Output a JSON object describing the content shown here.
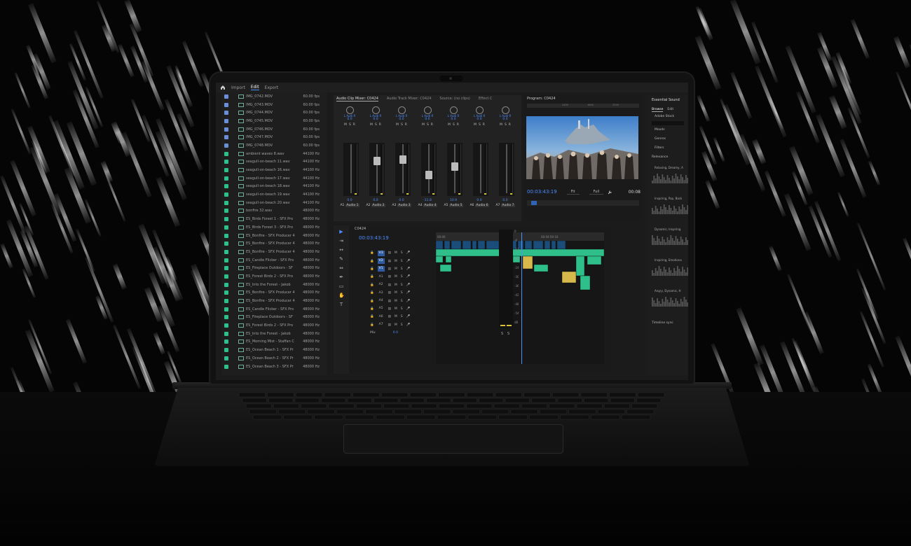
{
  "app": {
    "workspace_tabs": [
      "Import",
      "Edit",
      "Export"
    ],
    "active_tab": "Edit"
  },
  "project": {
    "items": [
      {
        "name": "IMG_0742.MOV",
        "rate": "60.00 fps",
        "type": "video"
      },
      {
        "name": "IMG_0743.MOV",
        "rate": "60.00 fps",
        "type": "video"
      },
      {
        "name": "IMG_0744.MOV",
        "rate": "60.00 fps",
        "type": "video"
      },
      {
        "name": "IMG_0745.MOV",
        "rate": "60.00 fps",
        "type": "video"
      },
      {
        "name": "IMG_0746.MOV",
        "rate": "60.00 fps",
        "type": "video"
      },
      {
        "name": "IMG_0747.MOV",
        "rate": "60.00 fps",
        "type": "video"
      },
      {
        "name": "IMG_0748.MOV",
        "rate": "60.00 fps",
        "type": "video"
      },
      {
        "name": "ambient waves 8.wav",
        "rate": "44100 Hz",
        "type": "audio"
      },
      {
        "name": "seagull-on-beach 11.wav",
        "rate": "44100 Hz",
        "type": "audio"
      },
      {
        "name": "seagull-on-beach 16.wav",
        "rate": "44100 Hz",
        "type": "audio"
      },
      {
        "name": "seagull-on-beach 17.wav",
        "rate": "44100 Hz",
        "type": "audio"
      },
      {
        "name": "seagull-on-beach 18.wav",
        "rate": "44100 Hz",
        "type": "audio"
      },
      {
        "name": "seagull-on-beach 19.wav",
        "rate": "44100 Hz",
        "type": "audio"
      },
      {
        "name": "seagull-on-beach 20.wav",
        "rate": "44100 Hz",
        "type": "audio"
      },
      {
        "name": "bonfire 32.wav",
        "rate": "48000 Hz",
        "type": "audio"
      },
      {
        "name": "ES_Birds Forest 1 - SFX Pro",
        "rate": "48000 Hz",
        "type": "audio"
      },
      {
        "name": "ES_Birds Forest 3 - SFX Pro",
        "rate": "48000 Hz",
        "type": "audio"
      },
      {
        "name": "ES_Bonfire - SFX Producer 4",
        "rate": "48000 Hz",
        "type": "audio"
      },
      {
        "name": "ES_Bonfire - SFX Producer 4",
        "rate": "48000 Hz",
        "type": "audio"
      },
      {
        "name": "ES_Bonfire - SFX Producer 4",
        "rate": "48000 Hz",
        "type": "audio"
      },
      {
        "name": "ES_Candle Flicker - SFX Pro",
        "rate": "48000 Hz",
        "type": "audio"
      },
      {
        "name": "ES_Fireplace Outdoors - SF",
        "rate": "48000 Hz",
        "type": "audio"
      },
      {
        "name": "ES_Forest Birds 2 - SFX Pro",
        "rate": "48000 Hz",
        "type": "audio"
      },
      {
        "name": "ES_Into the Forest - Jakob",
        "rate": "48000 Hz",
        "type": "audio"
      },
      {
        "name": "ES_Bonfire - SFX Producer 4",
        "rate": "48000 Hz",
        "type": "audio"
      },
      {
        "name": "ES_Bonfire - SFX Producer 4",
        "rate": "48000 Hz",
        "type": "audio"
      },
      {
        "name": "ES_Candle Flicker - SFX Pro",
        "rate": "48000 Hz",
        "type": "audio"
      },
      {
        "name": "ES_Fireplace Outdoors - SF",
        "rate": "48000 Hz",
        "type": "audio"
      },
      {
        "name": "ES_Forest Birds 2 - SFX Pro",
        "rate": "48000 Hz",
        "type": "audio"
      },
      {
        "name": "ES_Into the Forest - Jakob",
        "rate": "48000 Hz",
        "type": "audio"
      },
      {
        "name": "ES_Morning Mist - Staffan C",
        "rate": "48000 Hz",
        "type": "audio"
      },
      {
        "name": "ES_Ocean Beach 1 - SFX Pr",
        "rate": "48000 Hz",
        "type": "audio"
      },
      {
        "name": "ES_Ocean Beach 2 - SFX Pr",
        "rate": "48000 Hz",
        "type": "audio"
      },
      {
        "name": "ES_Ocean Beach 3 - SFX Pr",
        "rate": "48000 Hz",
        "type": "audio"
      }
    ]
  },
  "mixer": {
    "tabs": [
      "Audio Clip Mixer: C0424",
      "Audio Track Mixer: C0424",
      "Source: (no clips)",
      "Effect C"
    ],
    "strips": [
      {
        "lr": "L Audi R",
        "val": "0.0",
        "level": "0.0",
        "name": "A1",
        "label": "Audio 1"
      },
      {
        "lr": "L Audi R",
        "val": "0.0",
        "level": "0.0",
        "name": "A2",
        "label": "Audio 2"
      },
      {
        "lr": "L Audi R",
        "val": "0.0",
        "level": "0.0",
        "name": "A3",
        "label": "Audio 3"
      },
      {
        "lr": "L Audi R",
        "val": "0.0",
        "level": "-11.8",
        "name": "A4",
        "label": "Audio 4"
      },
      {
        "lr": "L Audi R",
        "val": "0.0",
        "level": "10.9",
        "name": "A5",
        "label": "Audio 5"
      },
      {
        "lr": "L Audi R",
        "val": "0.0",
        "level": "0.0",
        "name": "A6",
        "label": "Audio 6"
      },
      {
        "lr": "L Audi R",
        "val": "0.0",
        "level": "0.0",
        "name": "A7",
        "label": "Audio 7"
      }
    ],
    "msr": [
      "M",
      "S",
      "R"
    ]
  },
  "program": {
    "title": "Program: C0424",
    "timecode": "00:03:43:19",
    "fit": "Fit",
    "quality": "Full",
    "end": "00:08",
    "ruler": [
      "",
      "2400",
      "1600",
      "3200"
    ]
  },
  "timeline": {
    "title": "C0424",
    "timecode": "00:03:43:19",
    "ruler_marks": [
      "00:00",
      "00:04:59:16"
    ],
    "tracks": [
      {
        "name": "V3"
      },
      {
        "name": "V2"
      },
      {
        "name": "V1"
      },
      {
        "name": "A1"
      },
      {
        "name": "A2"
      },
      {
        "name": "A3"
      },
      {
        "name": "A4"
      },
      {
        "name": "A5"
      },
      {
        "name": "A6"
      },
      {
        "name": "A7"
      }
    ],
    "mix_label": "Mix",
    "mix_value": "0.0",
    "vu_labels": [
      "0",
      "-6",
      "-12",
      "-18",
      "-24",
      "-30",
      "-36",
      "-42",
      "-48",
      "-54",
      "dB"
    ],
    "vu_solo": [
      "S",
      "S"
    ]
  },
  "essential_sound": {
    "title": "Essential Sound",
    "tabs": [
      "Browse",
      "Edit"
    ],
    "stock": "Adobe Stock",
    "filters": [
      "Moods",
      "Genres",
      "Filters"
    ],
    "sort": "Relevance",
    "results": [
      "Relaxing, Dreamy, A",
      "Inspiring, Pop, Back",
      "Dynamic, Inspiring",
      "Inspiring, Emotiona",
      "Angry, Dynamic, H"
    ],
    "timeline_sync": "Timeline sync"
  },
  "colors": {
    "accent": "#4c8dff",
    "audio_clip": "#2fbf8a",
    "video_clip": "#1a4d7a",
    "project_video_chip": "#6a8fd6",
    "project_audio_chip": "#2fbf8a",
    "meter_yellow": "#d6c234"
  }
}
